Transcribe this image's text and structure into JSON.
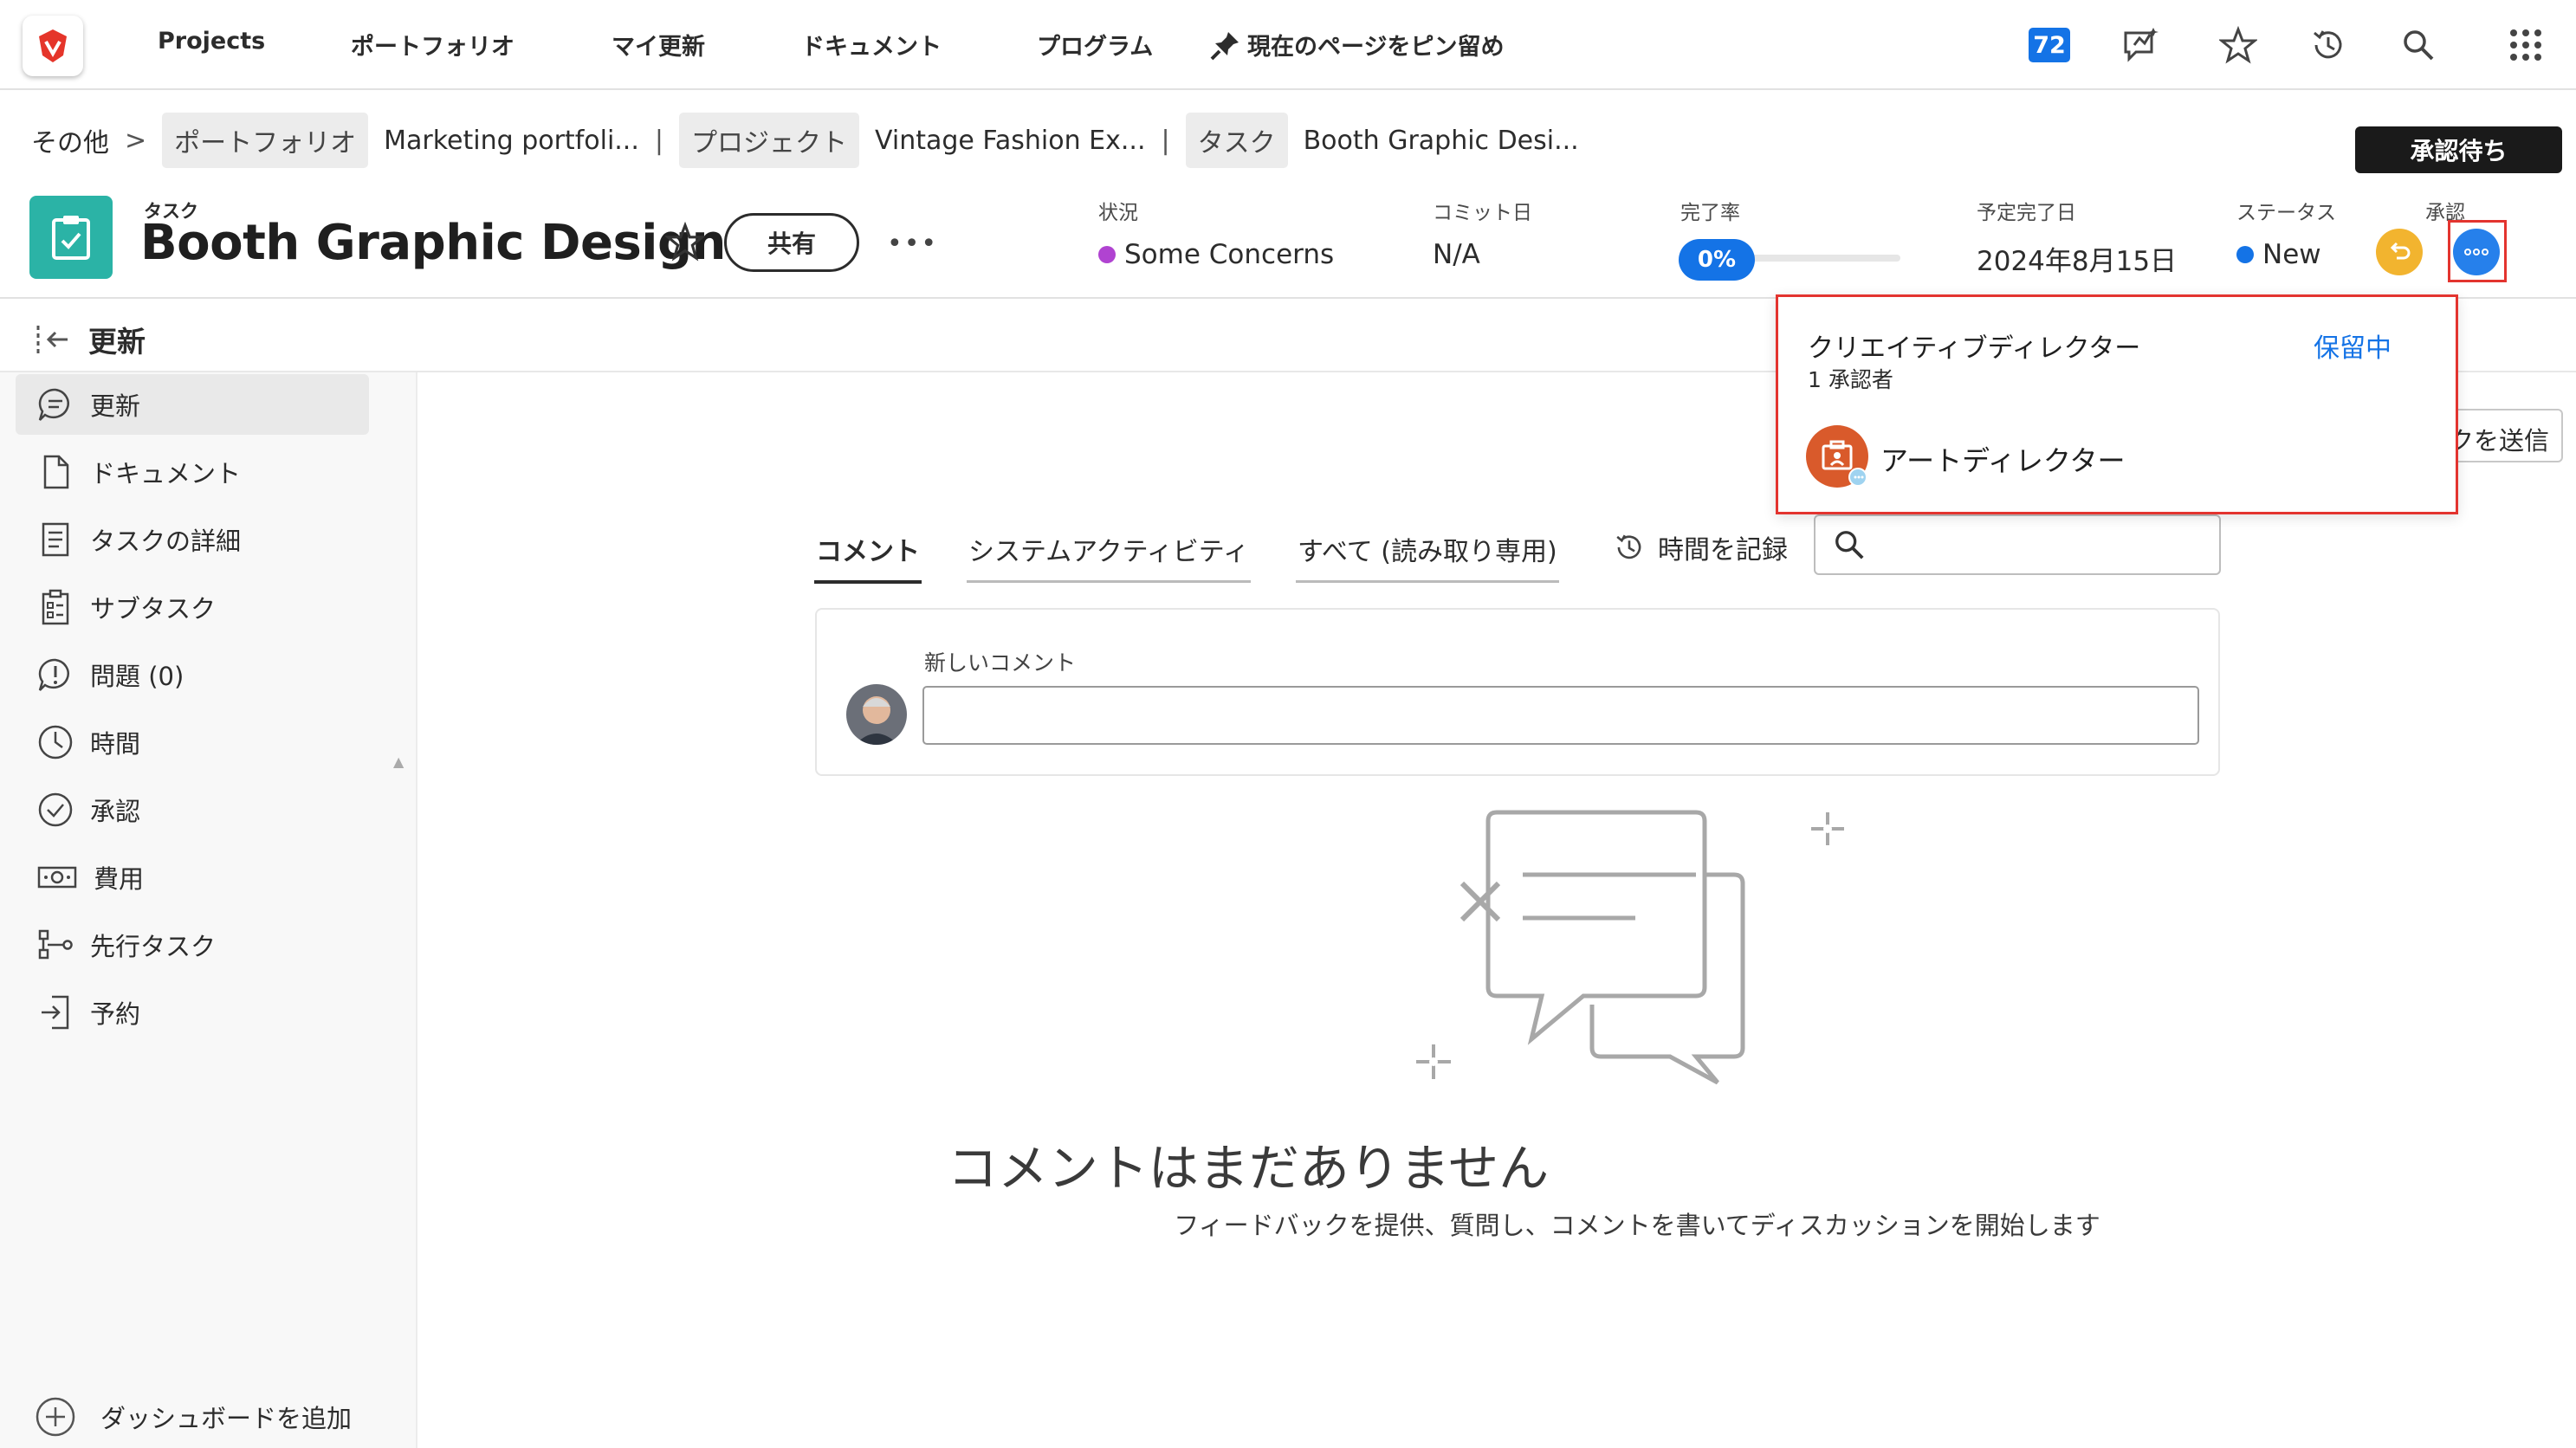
{
  "nav": {
    "items": [
      "Projects",
      "ポートフォリオ",
      "マイ更新",
      "ドキュメント",
      "プログラム"
    ],
    "pin_label": "現在のページをピン留め",
    "notification_count": "72"
  },
  "breadcrumb": {
    "more": "その他",
    "chevron": ">",
    "portfolio_tag": "ポートフォリオ",
    "portfolio_name": "Marketing portfoli...",
    "project_tag": "プロジェクト",
    "project_name": "Vintage Fashion Ex...",
    "task_tag": "タスク",
    "task_name": "Booth Graphic Desi...",
    "sep": "|"
  },
  "approval_pending_button": "承認待ち",
  "header": {
    "type_label": "タスク",
    "title": "Booth Graphic Design",
    "share_label": "共有",
    "more": "•••"
  },
  "meta": {
    "condition_label": "状況",
    "condition_value": "Some Concerns",
    "condition_color": "#b043d1",
    "commit_label": "コミット日",
    "commit_value": "N/A",
    "percent_label": "完了率",
    "percent_value": "0%",
    "percent_complete": 0,
    "planned_label": "予定完了日",
    "planned_value": "2024年8月15日",
    "status_label": "ステータス",
    "status_value": "New",
    "status_color": "#1473e6",
    "approval_label": "承認"
  },
  "subheader": {
    "title": "更新"
  },
  "sidebar": {
    "items": [
      {
        "label": "更新",
        "icon": "comment-icon"
      },
      {
        "label": "ドキュメント",
        "icon": "document-icon"
      },
      {
        "label": "タスクの詳細",
        "icon": "details-icon"
      },
      {
        "label": "サブタスク",
        "icon": "subtask-icon"
      },
      {
        "label": "問題 (0)",
        "icon": "issue-icon"
      },
      {
        "label": "時間",
        "icon": "clock-icon"
      },
      {
        "label": "承認",
        "icon": "check-circle-icon"
      },
      {
        "label": "費用",
        "icon": "money-icon"
      },
      {
        "label": "先行タスク",
        "icon": "predecessor-icon"
      },
      {
        "label": "予約",
        "icon": "booking-icon"
      }
    ],
    "add_dashboard": "ダッシュボードを追加"
  },
  "main": {
    "tabs": [
      "コメント",
      "システムアクティビティ",
      "すべて (読み取り専用)"
    ],
    "log_time": "時間を記録",
    "new_comment_label": "新しいコメント",
    "empty_title": "コメントはまだありません",
    "empty_desc": "フィードバックを提供、質問し、コメントを書いてディスカッションを開始します",
    "send_button": "クを送信"
  },
  "popover": {
    "role": "クリエイティブディレクター",
    "approver_count": "1 承認者",
    "status": "保留中",
    "approver_name": "アートディレクター"
  }
}
